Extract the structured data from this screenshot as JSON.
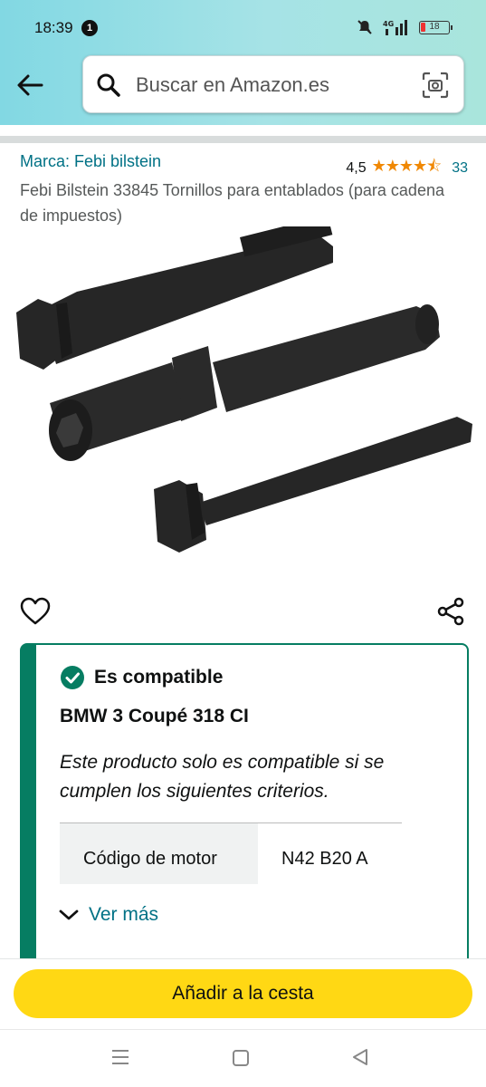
{
  "status_bar": {
    "time": "18:39",
    "notification_count": "1",
    "network": "4G",
    "battery": "18"
  },
  "search": {
    "placeholder": "Buscar en Amazon.es"
  },
  "product": {
    "brand": "Marca: Febi bilstein",
    "rating_value": "4,5",
    "stars": "★★★★⯪",
    "rating_count": "33",
    "title": "Febi Bilstein 33845 Tornillos para entablados (para cadena de impuestos)"
  },
  "compatibility": {
    "status": "Es compatible",
    "vehicle": "BMW 3 Coupé 318 CI",
    "note": "Este producto solo es compatible si se cumplen los siguientes criterios.",
    "criteria": [
      {
        "key": "Código de motor",
        "value": "N42 B20 A"
      }
    ],
    "see_more": "Ver más"
  },
  "actions": {
    "add_to_cart": "Añadir a la cesta"
  },
  "colors": {
    "accent_teal": "#007185",
    "compatible_green": "#067d62",
    "button_yellow": "#ffd814",
    "star_orange": "#f08804"
  }
}
